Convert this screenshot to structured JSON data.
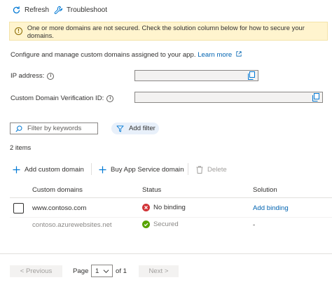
{
  "toolbar": {
    "refresh_label": "Refresh",
    "troubleshoot_label": "Troubleshoot"
  },
  "banner": {
    "message": "One or more domains are not secured. Check the solution column below for how to secure your domains."
  },
  "description": {
    "text": "Configure and manage custom domains assigned to your app.",
    "link": "Learn more"
  },
  "fields": {
    "ip_label": "IP address:",
    "ip_value": "",
    "verification_label": "Custom Domain Verification ID:",
    "verification_value": ""
  },
  "filter": {
    "placeholder": "Filter by keywords",
    "add_filter_label": "Add filter"
  },
  "items_count": "2 items",
  "commands": {
    "add_custom_domain": "Add custom domain",
    "buy_domain": "Buy App Service domain",
    "delete": "Delete"
  },
  "table": {
    "columns": [
      "Custom domains",
      "Status",
      "Solution"
    ],
    "rows": [
      {
        "domain": "www.contoso.com",
        "status": "No binding",
        "solution": "Add binding"
      },
      {
        "domain": "contoso.azurewebsites.net",
        "status": "Secured",
        "solution": "-"
      }
    ]
  },
  "pagination": {
    "previous": "< Previous",
    "page_label": "Page",
    "page_value": "1",
    "of_label": "of 1",
    "next": "Next >"
  },
  "colors": {
    "accent": "#0078d4",
    "link": "#0063b1",
    "warning_bg": "#fff4ce",
    "error": "#d13438",
    "success": "#57a300"
  }
}
